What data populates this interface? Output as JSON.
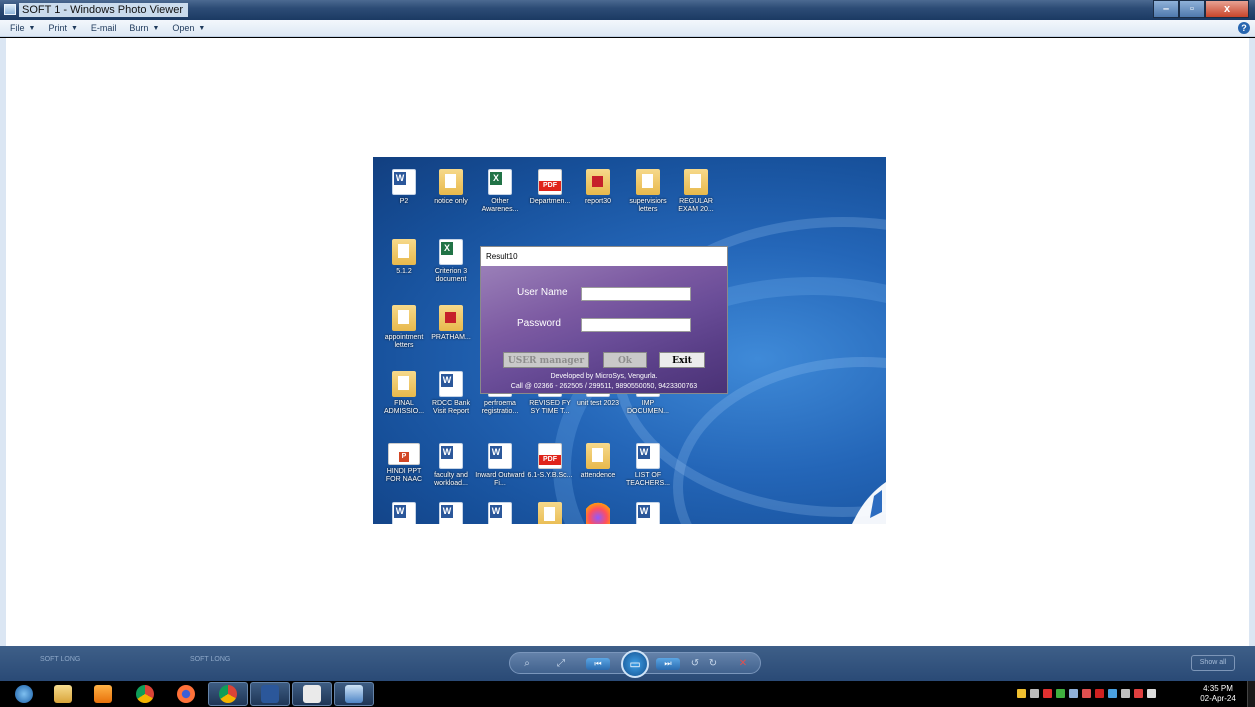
{
  "window": {
    "title": "SOFT 1 - Windows Photo Viewer",
    "buttons": {
      "minimize": "–",
      "maximize": "▫",
      "close": "x"
    }
  },
  "menu": {
    "items": [
      {
        "label": "File",
        "has_arrow": true
      },
      {
        "label": "Print",
        "has_arrow": true
      },
      {
        "label": "E-mail",
        "has_arrow": false
      },
      {
        "label": "Burn",
        "has_arrow": true
      },
      {
        "label": "Open",
        "has_arrow": true
      }
    ],
    "help_icon": "?"
  },
  "desktop_icons": [
    {
      "label": "P2",
      "type": "word-icon"
    },
    {
      "label": "notice only",
      "type": "folder-icon"
    },
    {
      "label": "Other Awarenes...",
      "type": "excel-icon"
    },
    {
      "label": "Departmen...",
      "type": "pdf-icon"
    },
    {
      "label": "report30",
      "type": "folder-red-icon"
    },
    {
      "label": "supervisiors letters",
      "type": "folder-icon"
    },
    {
      "label": "REGULAR EXAM 20...",
      "type": "folder-icon"
    },
    {
      "label": "5.1.2",
      "type": "folder-icon"
    },
    {
      "label": "Criterion 3 document",
      "type": "excel-icon"
    },
    {
      "label": "appointment letters",
      "type": "folder-icon"
    },
    {
      "label": "PRATHAM...",
      "type": "folder-red-icon"
    },
    {
      "label": "FINAL ADMISSIO...",
      "type": "folder-icon"
    },
    {
      "label": "RDCC Bank Visit Report",
      "type": "word-icon"
    },
    {
      "label": "perfroema registratio...",
      "type": "word-icon"
    },
    {
      "label": "REVISED FY SY TIME T...",
      "type": "word-icon"
    },
    {
      "label": "unit test 2023",
      "type": "word-icon"
    },
    {
      "label": "IMP DOCUMEN...",
      "type": "word-icon"
    },
    {
      "label": "HINDI PPT FOR NAAC",
      "type": "ppt-icon"
    },
    {
      "label": "faculty and workload...",
      "type": "word-icon"
    },
    {
      "label": "Inward Outward Fi...",
      "type": "word-icon"
    },
    {
      "label": "6.1-S.Y.B.Sc...",
      "type": "pdf-icon"
    },
    {
      "label": "attendence",
      "type": "folder-icon"
    },
    {
      "label": "LIST OF TEACHERS...",
      "type": "word-icon"
    },
    {
      "label": "",
      "type": "word-icon"
    },
    {
      "label": "",
      "type": "word-icon"
    },
    {
      "label": "",
      "type": "word-icon"
    },
    {
      "label": "",
      "type": "folder-icon"
    },
    {
      "label": "",
      "type": "firefox-icon"
    },
    {
      "label": "",
      "type": "word-icon"
    }
  ],
  "login_dialog": {
    "title": "Result10",
    "username_label": "User Name",
    "username_value": "",
    "password_label": "Password",
    "password_value": "",
    "user_manager_button": "USER manager",
    "ok_button": "Ok",
    "exit_button": "Exit",
    "footer_line1": "Developed by MicroSys, Vengurla.",
    "footer_line2": "Call @ 02366 - 262505 / 299511, 9890550050, 9423300763"
  },
  "viewer_controls": {
    "ghost_tab_1": "SOFT LONG",
    "ghost_tab_2": "SOFT LONG",
    "show_all": "Show all",
    "icons": [
      "zoom-icon",
      "actual-size-icon",
      "previous-icon",
      "slideshow-icon",
      "next-icon",
      "rotate-left-icon",
      "rotate-right-icon",
      "delete-icon"
    ]
  },
  "taskbar": {
    "apps": [
      "start-orb-icon",
      "file-explorer-icon",
      "media-player-icon",
      "chrome-icon",
      "firefox-icon",
      "google-chrome-alt-icon",
      "word-icon",
      "excel-icon",
      "photo-viewer-icon"
    ],
    "clock_time": "4:35 PM",
    "clock_date": "02-Apr-24"
  },
  "colors": {
    "titlebar": "#2d4c76",
    "dialog_gradient_top": "#9a7fb8",
    "dialog_gradient_bottom": "#4a3276",
    "desktop_blue": "#2466b8"
  }
}
